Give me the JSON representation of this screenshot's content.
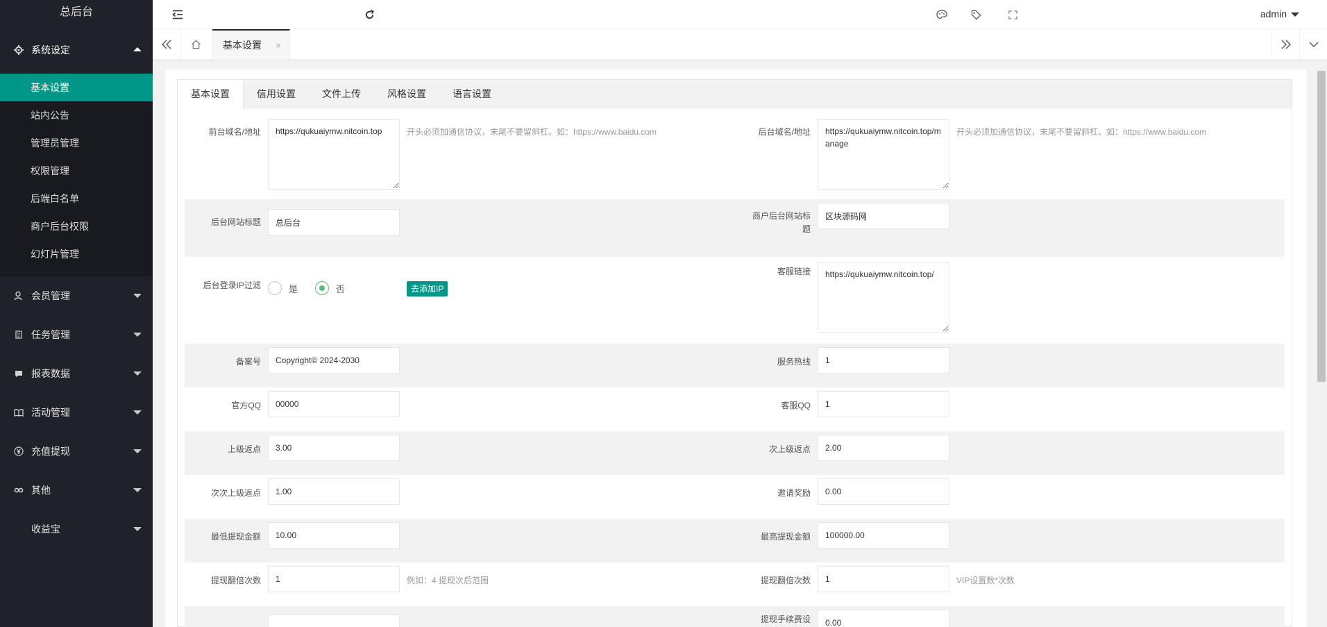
{
  "sidebar": {
    "logo": "总后台",
    "system": {
      "label": "系统设定",
      "items": [
        "基本设置",
        "站内公告",
        "管理员管理",
        "权限管理",
        "后端白名单",
        "商户后台权限",
        "幻灯片管理"
      ]
    },
    "groups": [
      {
        "label": "会员管理",
        "icon": "user-icon"
      },
      {
        "label": "任务管理",
        "icon": "document-icon"
      },
      {
        "label": "报表数据",
        "icon": "chat-icon"
      },
      {
        "label": "活动管理",
        "icon": "book-icon"
      },
      {
        "label": "充值提现",
        "icon": "yen-icon"
      },
      {
        "label": "其他",
        "icon": "link-icon"
      },
      {
        "label": "收益宝",
        "icon": ""
      }
    ]
  },
  "header": {
    "user": "admin"
  },
  "tabsbar": {
    "active_tab": "基本设置",
    "close": "×"
  },
  "content": {
    "tabs": [
      "基本设置",
      "信用设置",
      "文件上传",
      "风格设置",
      "语言设置"
    ],
    "form": {
      "front_domain": {
        "label": "前台域名/地址",
        "value": "https://qukuaiymw.nitcoin.top",
        "tip": "开头必须加通信协议，末尾不要留斜杠。如：https://www.baidu.com"
      },
      "back_domain": {
        "label": "后台域名/地址",
        "value": "https://qukuaiymw.nitcoin.top/manage",
        "tip": "开头必须加通信协议，末尾不要留斜杠。如：https://www.baidu.com"
      },
      "admin_title": {
        "label": "后台网站标题",
        "value": "总后台"
      },
      "merchant_title": {
        "label": "商户后台网站标题",
        "value": "区块源码网"
      },
      "ip_filter": {
        "label": "后台登录IP过滤",
        "yes": "是",
        "no": "否",
        "button": "去添加IP"
      },
      "service_link": {
        "label": "客服链接",
        "value": "https://qukuaiymw.nitcoin.top/"
      },
      "icp": {
        "label": "备案号",
        "value": "Copyright© 2024-2030"
      },
      "hotline": {
        "label": "服务热线",
        "value": "1"
      },
      "official_qq": {
        "label": "官方QQ",
        "value": "00000"
      },
      "service_qq": {
        "label": "客服QQ",
        "value": "1"
      },
      "upper_rebate": {
        "label": "上级返点",
        "value": "3.00"
      },
      "second_rebate": {
        "label": "次上级返点",
        "value": "2.00"
      },
      "third_rebate": {
        "label": "次次上级返点",
        "value": "1.00"
      },
      "invite_reward": {
        "label": "邀请奖励",
        "value": "0.00"
      },
      "min_withdraw": {
        "label": "最低提现金额",
        "value": "10.00"
      },
      "max_withdraw": {
        "label": "最高提现金额",
        "value": "100000.00"
      },
      "withdraw_times": {
        "label": "提现翻倍次数",
        "value": "1",
        "tip": "例如：4 提现次后范围"
      },
      "withdraw_times2": {
        "label": "提现翻倍次数",
        "value": "1",
        "tip": "VIP设置数*次数"
      },
      "last_left_value": "",
      "last_right_label": "提现手续费设",
      "last_right_value": "0.00"
    }
  }
}
